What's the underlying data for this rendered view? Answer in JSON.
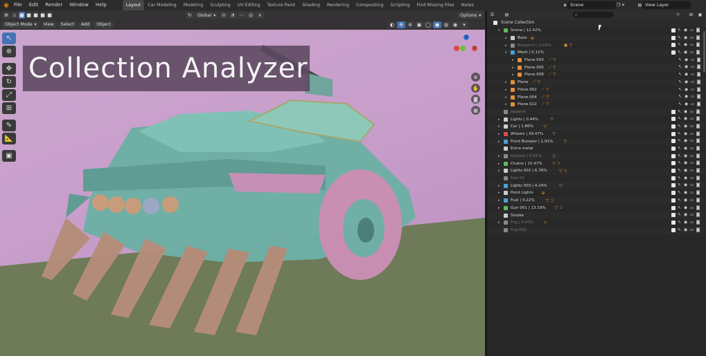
{
  "menu": [
    "File",
    "Edit",
    "Render",
    "Window",
    "Help"
  ],
  "workspaces": [
    "Layout",
    "Car Modeling",
    "Modeling",
    "Sculpting",
    "UV Editing",
    "Texture Paint",
    "Shading",
    "Rendering",
    "Compositing",
    "Scripting",
    "Find Missing Files",
    "Notes"
  ],
  "active_workspace": "Layout",
  "scene_field": "Scene",
  "view_layer_field": "View Layer",
  "viewport": {
    "orientation": "Global",
    "options": "Options",
    "mode": "Object Mode",
    "menu": [
      "View",
      "Select",
      "Add",
      "Object"
    ]
  },
  "title_overlay": "Collection Analyzer",
  "outliner": {
    "root": "Scene Collection",
    "rows": [
      {
        "name": "Scene  |  12.42%",
        "indent": 1,
        "arrow": "▾",
        "color": "#5fb85f",
        "dim": false,
        "extras": ""
      },
      {
        "name": "Base",
        "indent": 2,
        "arrow": "▸",
        "color": "#cccccc",
        "dim": false,
        "extras": "⊕"
      },
      {
        "name": "Blueprint  |  0.00%",
        "indent": 2,
        "arrow": "▸",
        "color": "#888888",
        "dim": true,
        "extras": "▣ ▽"
      },
      {
        "name": "Mesh  |  0.11%",
        "indent": 2,
        "arrow": "▾",
        "color": "#4aa0d8",
        "dim": false,
        "extras": ""
      },
      {
        "name": "Plane.003",
        "indent": 3,
        "arrow": "▸",
        "color": "#e3913a",
        "dim": false,
        "extras": "⟋ ▽"
      },
      {
        "name": "Plane.005",
        "indent": 3,
        "arrow": "▸",
        "color": "#e3913a",
        "dim": false,
        "extras": "⟋ ▽"
      },
      {
        "name": "Plane.008",
        "indent": 3,
        "arrow": "▸",
        "color": "#e3913a",
        "dim": false,
        "extras": "⟋ ▽"
      },
      {
        "name": "Plane",
        "indent": 2,
        "arrow": "▸",
        "color": "#e3913a",
        "dim": false,
        "extras": "⟋ ▽"
      },
      {
        "name": "Plane.002",
        "indent": 2,
        "arrow": "▸",
        "color": "#e3913a",
        "dim": false,
        "extras": "⟋ ▽"
      },
      {
        "name": "Plane.004",
        "indent": 2,
        "arrow": "▸",
        "color": "#e3913a",
        "dim": false,
        "extras": "⟋ ▽"
      },
      {
        "name": "Plane.022",
        "indent": 2,
        "arrow": "▸",
        "color": "#e3913a",
        "dim": false,
        "extras": "⟋ ▽"
      },
      {
        "name": "Append",
        "indent": 1,
        "arrow": "",
        "color": "#888888",
        "dim": true,
        "extras": ""
      },
      {
        "name": "Lights  |  0.44%",
        "indent": 1,
        "arrow": "▸",
        "color": "#cccccc",
        "dim": false,
        "extras": "▽"
      },
      {
        "name": "Car  |  1.86%",
        "indent": 1,
        "arrow": "▸",
        "color": "#cccccc",
        "dim": false,
        "extras": "▽"
      },
      {
        "name": "Wheels  |  39.47%",
        "indent": 1,
        "arrow": "▸",
        "color": "#d94c4c",
        "dim": false,
        "extras": "▽"
      },
      {
        "name": "Front Bumper  |  1.91%",
        "indent": 1,
        "arrow": "▸",
        "color": "#4aa0d8",
        "dim": false,
        "extras": "▽"
      },
      {
        "name": "Extra metal",
        "indent": 1,
        "arrow": "",
        "color": "#cccccc",
        "dim": false,
        "extras": ""
      },
      {
        "name": "Glasses  |  0.01%",
        "indent": 1,
        "arrow": "▸",
        "color": "#888888",
        "dim": true,
        "extras": "▽"
      },
      {
        "name": "Chains  |  15.47%",
        "indent": 1,
        "arrow": "▸",
        "color": "#5fb85f",
        "dim": false,
        "extras": "▽ ⊃"
      },
      {
        "name": "Lights 002  |  6.76%",
        "indent": 1,
        "arrow": "▸",
        "color": "#cccccc",
        "dim": false,
        "extras": "▽ ⊃"
      },
      {
        "name": "Fast 01",
        "indent": 1,
        "arrow": "",
        "color": "#888888",
        "dim": true,
        "extras": ""
      },
      {
        "name": "Lights 003  |  4.24%",
        "indent": 1,
        "arrow": "▸",
        "color": "#4aa0d8",
        "dim": false,
        "extras": "▽"
      },
      {
        "name": "Point Lights",
        "indent": 1,
        "arrow": "▸",
        "color": "#cccccc",
        "dim": false,
        "extras": "⊕"
      },
      {
        "name": "Fuel  |  4.22%",
        "indent": 1,
        "arrow": "▸",
        "color": "#4aa0d8",
        "dim": false,
        "extras": "▽ ⊃"
      },
      {
        "name": "Gun 001  |  13.19%",
        "indent": 1,
        "arrow": "▸",
        "color": "#5fb85f",
        "dim": false,
        "extras": "▽ ⊃"
      },
      {
        "name": "Smoke",
        "indent": 1,
        "arrow": "",
        "color": "#cccccc",
        "dim": false,
        "extras": ""
      },
      {
        "name": "Fog  |  0.00%",
        "indent": 1,
        "arrow": "▸",
        "color": "#888888",
        "dim": true,
        "extras": "▽"
      },
      {
        "name": "Fog 002",
        "indent": 1,
        "arrow": "",
        "color": "#888888",
        "dim": true,
        "extras": ""
      }
    ]
  },
  "colors": {
    "accent": "#4772b3",
    "blender_orange": "#e87d0d"
  }
}
